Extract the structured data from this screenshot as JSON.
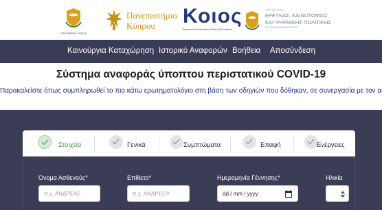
{
  "logos": {
    "moh_caption": "ΥΠΟΥΡΓΕΙΟ ΥΓΕΙΑΣ",
    "ucy_line1": "Πανεπιστήμιο",
    "ucy_line2": "Κύπρου",
    "koios_word": "Κοιος",
    "koios_sub": "Research and Innovation Center of Excellence",
    "mrid_top": "ΥΦΥΠΟΥΡΓΕΙΟ",
    "mrid_line1": "ΕΡΕΥΝΑΣ, ΚΑΙΝΟΤΟΜΙΑΣ",
    "mrid_line2": "ΚΑΙ ΨΗΦΙΑΚΗΣ ΠΟΛΙΤΙΚΗΣ",
    "mrid_bottom": "ΚΥΠΡΙΑΚΗ ΔΗΜΟΚΡΑΤΙΑ"
  },
  "nav": {
    "items": [
      "Καινούργια Καταχώρηση",
      "Ιστορικό Αναφορών",
      "Βοήθεια",
      "Αποσύνδεση"
    ]
  },
  "page": {
    "title": "Σύστημα αναφοράς ύποπτου περιστατικού COVID-19",
    "subtitle": "Παρακαλείστε όπως συμπληρωθεί το πιο κάτω ερωτηματολόγιο στη βάση των οδηγιών που δόθηκαν, σε συνεργασία με τον ασθενή"
  },
  "stepper": {
    "steps": [
      {
        "label": "Στοιχεία",
        "active": true
      },
      {
        "label": "Γενικά",
        "active": false
      },
      {
        "label": "Συμπτώματα",
        "active": false
      },
      {
        "label": "Επαφή",
        "active": false
      },
      {
        "label": "Ενέργειες",
        "active": false
      }
    ]
  },
  "form": {
    "name_label": "Όνομα Ασθενούς*",
    "name_placeholder": "π.χ. ΑΝΔΡΕΑΣ",
    "surname_label": "Επίθετο*",
    "surname_placeholder": "π.χ. ΑΝΔΡΕΟΥ",
    "dob_label": "Ημερομηνία Γέννησης*",
    "dob_placeholder": "dd / mm / yyyy",
    "age_label": "Ηλικία"
  },
  "colors": {
    "nav_bg": "#3a3b56",
    "accent_green": "#4a8f57",
    "subtitle_blue": "#1e2a7a"
  }
}
